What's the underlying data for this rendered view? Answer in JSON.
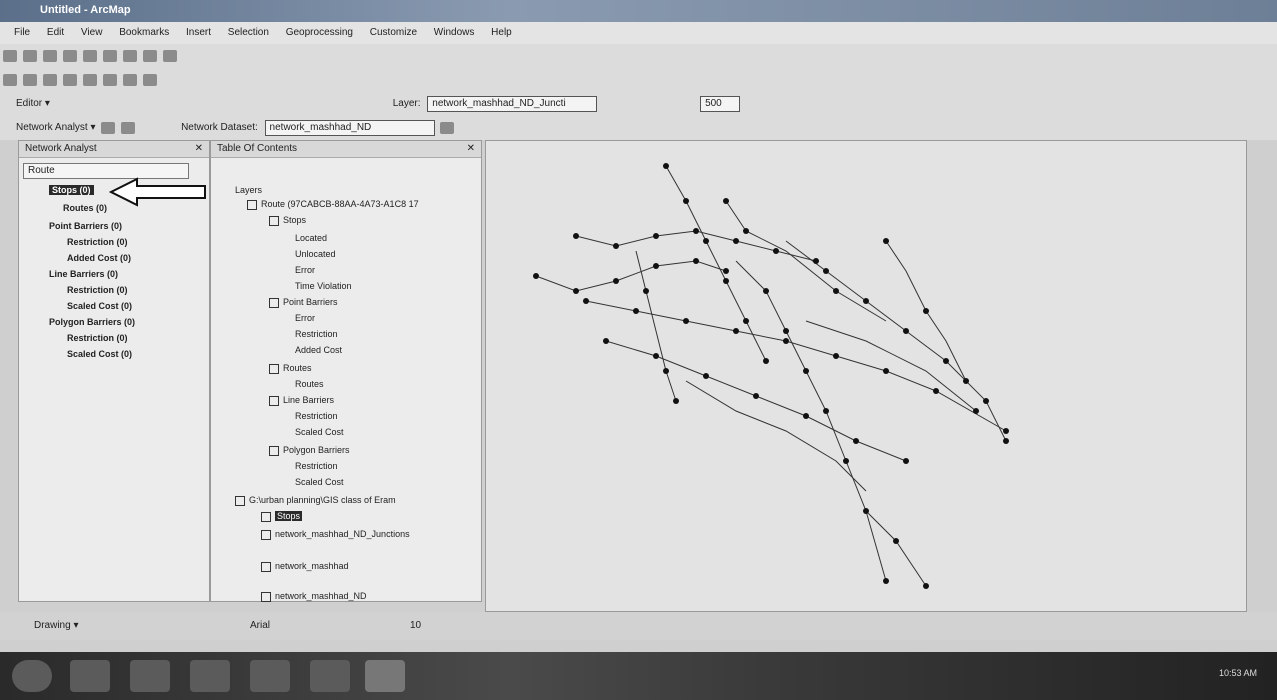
{
  "window": {
    "title": "Untitled - ArcMap"
  },
  "menu": [
    "File",
    "Edit",
    "View",
    "Bookmarks",
    "Insert",
    "Selection",
    "Geoprocessing",
    "Customize",
    "Windows",
    "Help"
  ],
  "toolbar3": {
    "editor": "Editor ▾",
    "layer_label": "Layer:",
    "layer_value": "network_mashhad_ND_Juncti",
    "scale": "500"
  },
  "toolbar4": {
    "na_label": "Network Analyst ▾",
    "dataset_label": "Network Dataset:",
    "dataset_value": "network_mashhad_ND"
  },
  "na_window": {
    "title": "Network Analyst",
    "route_select": "Route",
    "items": [
      {
        "label": "Stops (0)"
      },
      {
        "label": "Routes (0)"
      },
      {
        "label": "Point Barriers (0)"
      },
      {
        "label": "Restriction (0)"
      },
      {
        "label": "Added Cost (0)"
      },
      {
        "label": "Line Barriers (0)"
      },
      {
        "label": "Restriction (0)"
      },
      {
        "label": "Scaled Cost (0)"
      },
      {
        "label": "Polygon Barriers (0)"
      },
      {
        "label": "Restriction (0)"
      },
      {
        "label": "Scaled Cost (0)"
      }
    ]
  },
  "toc": {
    "title": "Table Of Contents",
    "items": [
      {
        "label": "Layers"
      },
      {
        "label": "Route (97CABCB-88AA-4A73-A1C8 17"
      },
      {
        "label": "Stops"
      },
      {
        "label": "Located"
      },
      {
        "label": "Unlocated"
      },
      {
        "label": "Error"
      },
      {
        "label": "Time Violation"
      },
      {
        "label": "Point Barriers"
      },
      {
        "label": "Error"
      },
      {
        "label": "Restriction"
      },
      {
        "label": "Added Cost"
      },
      {
        "label": "Routes"
      },
      {
        "label": "Routes"
      },
      {
        "label": "Line Barriers"
      },
      {
        "label": "Restriction"
      },
      {
        "label": "Scaled Cost"
      },
      {
        "label": "Polygon Barriers"
      },
      {
        "label": "Restriction"
      },
      {
        "label": "Scaled Cost"
      },
      {
        "label": "G:\\urban planning\\GIS class of Eram"
      },
      {
        "label": "Stops"
      },
      {
        "label": "network_mashhad_ND_Junctions"
      },
      {
        "label": "network_mashhad"
      },
      {
        "label": "network_mashhad_ND"
      }
    ]
  },
  "drawing": {
    "label": "Drawing ▾",
    "font": "Arial",
    "size": "10"
  },
  "taskbar": {
    "clock": "10:53 AM"
  }
}
